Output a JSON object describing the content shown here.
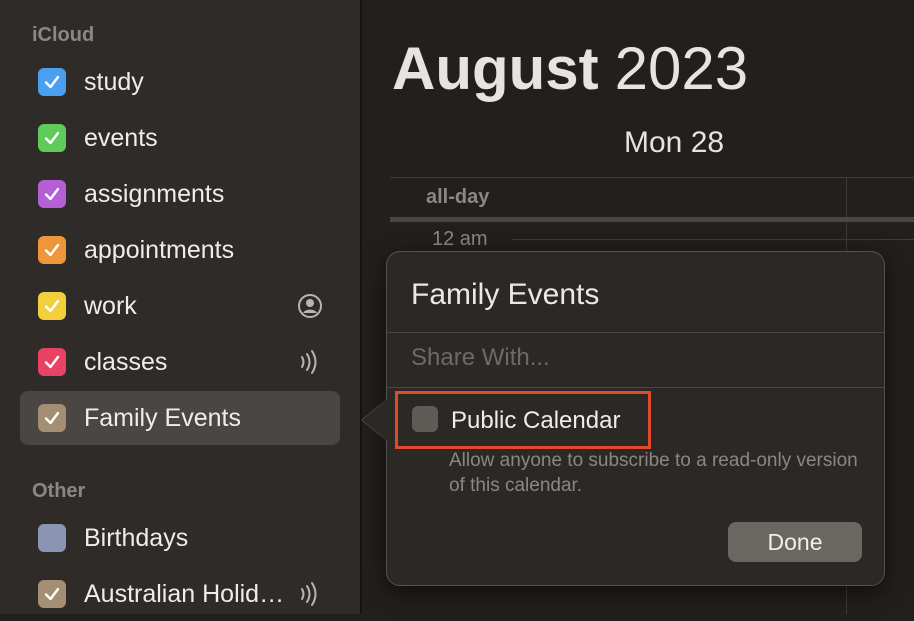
{
  "sidebar": {
    "icloud_header": "iCloud",
    "other_header": "Other",
    "icloud_items": [
      {
        "label": "study",
        "color": "#4aa0f0",
        "checked": true
      },
      {
        "label": "events",
        "color": "#5ecb5a",
        "checked": true
      },
      {
        "label": "assignments",
        "color": "#b45fd6",
        "checked": true
      },
      {
        "label": "appointments",
        "color": "#f0963a",
        "checked": true
      },
      {
        "label": "work",
        "color": "#f2cf3c",
        "checked": true,
        "right_icon": "person-circle-icon"
      },
      {
        "label": "classes",
        "color": "#e84365",
        "checked": true,
        "right_icon": "broadcast-icon"
      },
      {
        "label": "Family Events",
        "color": "#a58f74",
        "checked": true,
        "selected": true
      }
    ],
    "other_items": [
      {
        "label": "Birthdays",
        "color": "#8a95b3",
        "checked": false
      },
      {
        "label": "Australian Holid…",
        "color": "#a58f74",
        "checked": true,
        "right_icon": "broadcast-icon"
      }
    ]
  },
  "main": {
    "month": "August",
    "year": "2023",
    "day_label": "Mon 28",
    "allday_label": "all-day",
    "hour_label": "12 am"
  },
  "popover": {
    "title": "Family Events",
    "share_placeholder": "Share With...",
    "public_checkbox_label": "Public Calendar",
    "public_checked": false,
    "public_description": "Allow anyone to subscribe to a read-only version of this calendar.",
    "done_label": "Done"
  },
  "colors": {
    "highlight": "#e04a2b"
  }
}
